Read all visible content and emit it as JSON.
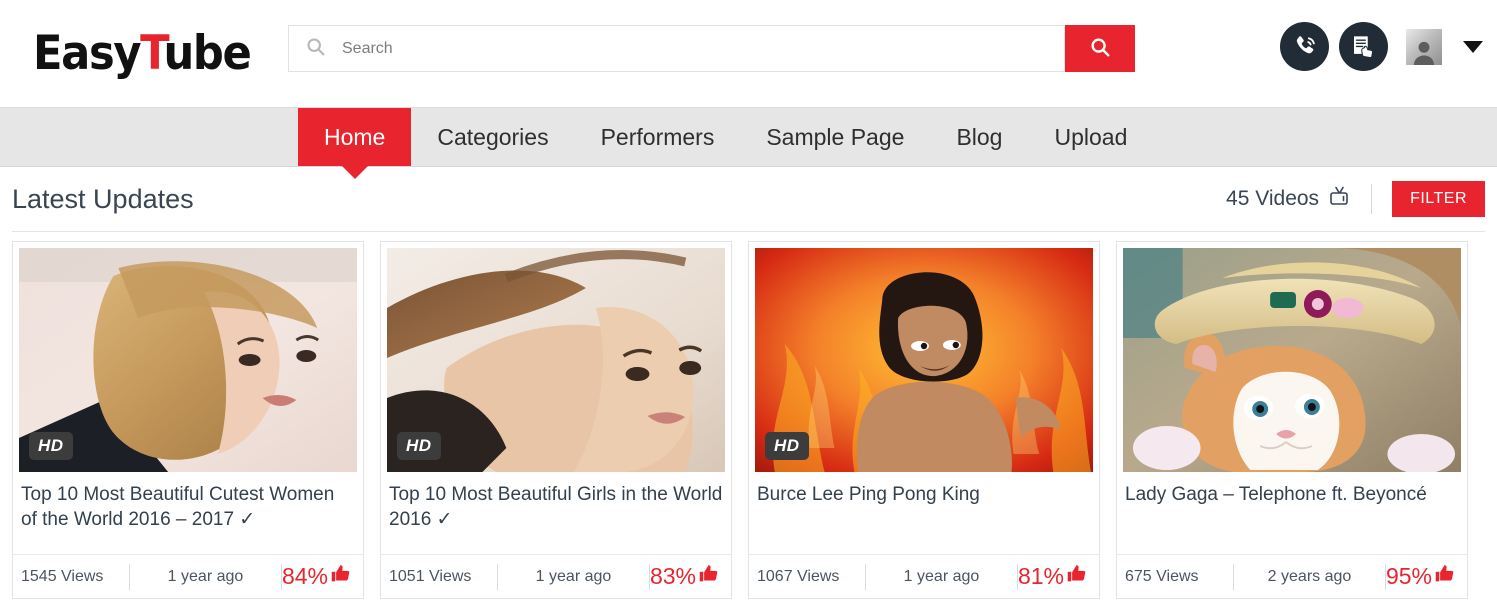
{
  "brand": {
    "name_part1": "Easy",
    "name_part2": "T",
    "name_part3": "ube"
  },
  "search": {
    "placeholder": "Search",
    "value": "",
    "icon": "search-icon",
    "button_icon": "search-icon"
  },
  "header_actions": {
    "call_icon": "phone-call-icon",
    "form_icon": "document-hand-icon",
    "avatar": "user-avatar-icon",
    "caret": "chevron-down-icon"
  },
  "nav": {
    "items": [
      {
        "label": "Home",
        "active": true
      },
      {
        "label": "Categories",
        "active": false
      },
      {
        "label": "Performers",
        "active": false
      },
      {
        "label": "Sample Page",
        "active": false
      },
      {
        "label": "Blog",
        "active": false
      },
      {
        "label": "Upload",
        "active": false
      }
    ]
  },
  "section": {
    "title": "Latest Updates",
    "video_count": "45 Videos",
    "count_icon": "tv-icon",
    "filter_label": "FILTER"
  },
  "colors": {
    "accent": "#e8252f",
    "nav_bg": "#e6e6e6",
    "text_dark": "#33404d",
    "badge_bg": "#3c3c3c"
  },
  "cards": [
    {
      "title": "Top 10 Most Beautiful Cutest Women of the World 2016 – 2017 ✓",
      "hd": "HD",
      "has_hd": true,
      "views": "1545 Views",
      "ago": "1 year ago",
      "rating": "84%",
      "thumb_alt": "blonde-woman-portrait"
    },
    {
      "title": "Top 10 Most Beautiful Girls in the World 2016 ✓",
      "hd": "HD",
      "has_hd": true,
      "views": "1051 Views",
      "ago": "1 year ago",
      "rating": "83%",
      "thumb_alt": "brunette-woman-portrait"
    },
    {
      "title": "Burce Lee Ping Pong King",
      "hd": "HD",
      "has_hd": true,
      "views": "1067 Views",
      "ago": "1 year ago",
      "rating": "81%",
      "thumb_alt": "martial-artist-flames"
    },
    {
      "title": "Lady Gaga – Telephone ft. Beyoncé",
      "hd": "",
      "has_hd": false,
      "views": "675 Views",
      "ago": "2 years ago",
      "rating": "95%",
      "thumb_alt": "kitten-with-straw-hat"
    }
  ]
}
